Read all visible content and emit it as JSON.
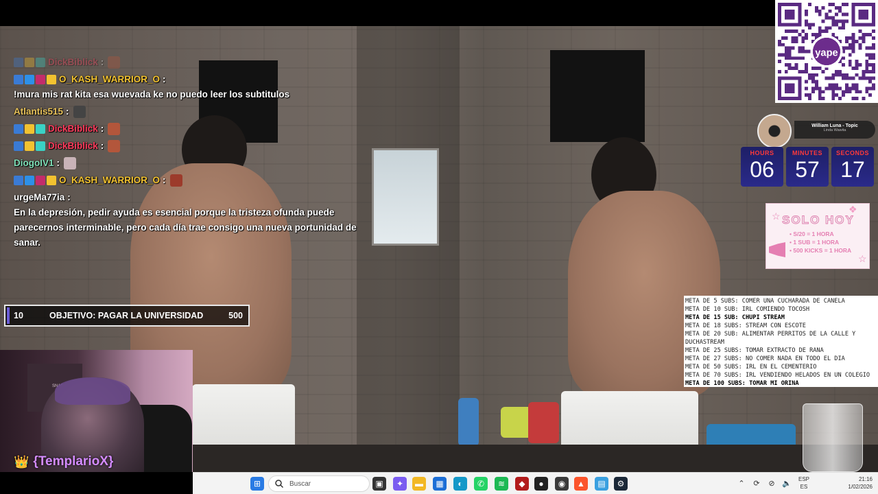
{
  "chat": {
    "lines": [
      {
        "user": "DickBiblick",
        "sep": ":",
        "msg": "",
        "color": "#ff3b5c",
        "faded": true,
        "badges": [
          "#3a7bd5",
          "#f2c230",
          "#3ad1c5"
        ],
        "emote": "#b3563b"
      },
      {
        "user": "O_KASH_WARRIOR_O",
        "sep": ":",
        "msg": "!mura mis rat kita esa wuevada ke no puedo leer los subtitulos",
        "color": "#f2c230",
        "faded": false,
        "badges": [
          "#3a7bd5",
          "#2d90e8",
          "#c32c6b",
          "#f2c230"
        ],
        "emote": ""
      },
      {
        "user": "Atlantis515",
        "sep": ":",
        "msg": "",
        "color": "#e8c25a",
        "faded": false,
        "badges": [],
        "emote": "#444444"
      },
      {
        "user": "DickBiblick",
        "sep": ":",
        "msg": "",
        "color": "#ff3b5c",
        "faded": false,
        "badges": [
          "#3a7bd5",
          "#f2c230",
          "#3ad1c5"
        ],
        "emote": "#b3563b"
      },
      {
        "user": "DickBiblick",
        "sep": ":",
        "msg": "",
        "color": "#ff3b5c",
        "faded": false,
        "badges": [
          "#3a7bd5",
          "#f2c230",
          "#3ad1c5"
        ],
        "emote": "#b3563b"
      },
      {
        "user": "DiogoIV1",
        "sep": ":",
        "msg": "",
        "color": "#7fe0b8",
        "faded": false,
        "badges": [],
        "emote": "#c9b3b8"
      },
      {
        "user": "O_KASH_WARRIOR_O",
        "sep": ":",
        "msg": "",
        "color": "#f2c230",
        "faded": false,
        "badges": [
          "#3a7bd5",
          "#2d90e8",
          "#c32c6b",
          "#f2c230"
        ],
        "emote": "#9c3b2b"
      },
      {
        "user": "urgeMa77ia",
        "sep": ":",
        "msg": "En la depresión, pedir ayuda es esencial porque la tristeza ofunda puede parecernos interminable, pero cada día trae consigo una nueva portunidad de sanar.",
        "color": "#ffffff",
        "faded": false,
        "badges": [],
        "emote": ""
      }
    ]
  },
  "goal": {
    "start": "10",
    "label": "OBJETIVO: PAGAR LA UNIVERSIDAD",
    "end": "500"
  },
  "webcam": {
    "name": "{TemplarioX}",
    "poster_text": "SNAP USER"
  },
  "music": {
    "song": "William Luna - Topic",
    "artist": "Linda Wawita"
  },
  "timer": {
    "cells": [
      {
        "label": "HOURS",
        "value": "06"
      },
      {
        "label": "MINUTES",
        "value": "57"
      },
      {
        "label": "SECONDS",
        "value": "17"
      }
    ]
  },
  "solo_hoy": {
    "title": "SOLO HOY",
    "items": [
      "S/20 = 1 HORA",
      "1 SUB = 1 HORA",
      "500 KICKS = 1 HORA"
    ]
  },
  "metas": [
    {
      "text": "META DE 5 SUBS: COMER UNA CUCHARADA DE CANELA",
      "bold": false
    },
    {
      "text": "META DE 10 SUB: IRL COMIENDO TOCOSH",
      "bold": false
    },
    {
      "text": "META DE 15 SUB: CHUPI STREAM",
      "bold": true
    },
    {
      "text": "META DE 18 SUBS: STREAM CON ESCOTE",
      "bold": false
    },
    {
      "text": "META DE 20 SUB:  ALIMENTAR PERRITOS DE LA CALLE Y DUCHASTREAM",
      "bold": false
    },
    {
      "text": "META DE 25 SUBS: TOMAR EXTRACTO DE RANA",
      "bold": false
    },
    {
      "text": "META DE 27 SUBS: NO COMER NADA EN TODO EL DIA",
      "bold": false
    },
    {
      "text": "META DE 50 SUBS: IRL EN EL CEMENTERIO",
      "bold": false
    },
    {
      "text": "META DE 70 SUBS: IRL VENDIENDO HELADOS EN UN COLEGIO",
      "bold": false
    },
    {
      "text": "META DE 100 SUBS: TOMAR MI ORINA",
      "bold": true
    }
  ],
  "qr": {
    "brand": "yape"
  },
  "taskbar": {
    "search_placeholder": "Buscar",
    "lang_top": "ESP",
    "lang_bottom": "ES",
    "time": "21:16",
    "date": "1/02/2026",
    "apps": [
      {
        "name": "start-icon",
        "color": "#2a7be4"
      },
      {
        "name": "task-view-icon",
        "color": "#333333"
      },
      {
        "name": "copilot-icon",
        "color": "#7a5cf0"
      },
      {
        "name": "file-explorer-icon",
        "color": "#f2b824"
      },
      {
        "name": "store-icon",
        "color": "#1d6fd6"
      },
      {
        "name": "edge-icon",
        "color": "#1598c8"
      },
      {
        "name": "whatsapp-icon",
        "color": "#25d366"
      },
      {
        "name": "spotify-icon",
        "color": "#1db954"
      },
      {
        "name": "dota-icon",
        "color": "#b21b1b"
      },
      {
        "name": "obs-icon",
        "color": "#222222"
      },
      {
        "name": "app-dark-icon",
        "color": "#3a3a3a"
      },
      {
        "name": "brave-icon",
        "color": "#fb542b"
      },
      {
        "name": "notepad-icon",
        "color": "#3aa0e0"
      },
      {
        "name": "steam-icon",
        "color": "#1b2838"
      }
    ]
  }
}
